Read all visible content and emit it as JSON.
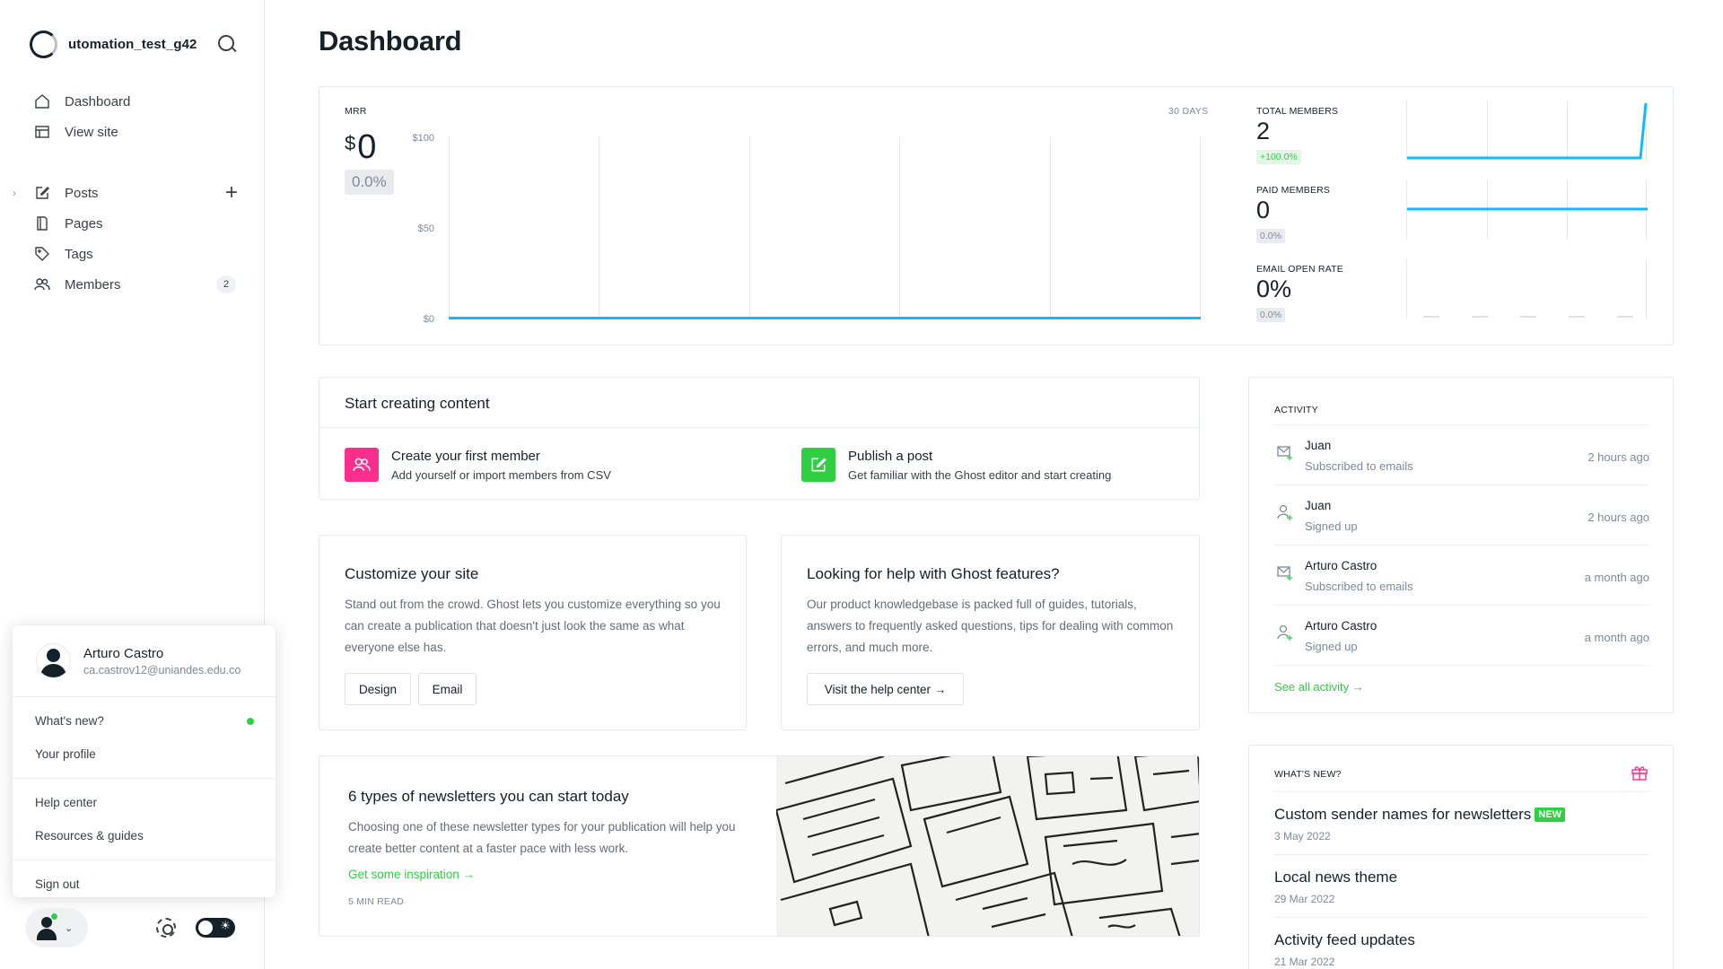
{
  "sidebar": {
    "site_name": "utomation_test_g42",
    "nav_top": [
      {
        "label": "Dashboard",
        "icon": "home-icon"
      },
      {
        "label": "View site",
        "icon": "browser-icon"
      }
    ],
    "nav_main": [
      {
        "label": "Posts",
        "icon": "edit-icon"
      },
      {
        "label": "Pages",
        "icon": "page-icon"
      },
      {
        "label": "Tags",
        "icon": "tag-icon"
      },
      {
        "label": "Members",
        "icon": "members-icon",
        "count": "2"
      }
    ]
  },
  "user_menu": {
    "name": "Arturo Castro",
    "email": "ca.castrov12@uniandes.edu.co",
    "items_group1": [
      "What's new?",
      "Your profile"
    ],
    "items_group2": [
      "Help center",
      "Resources & guides"
    ],
    "items_group3": [
      "Sign out"
    ]
  },
  "page": {
    "title": "Dashboard"
  },
  "mrr": {
    "label": "MRR",
    "currency": "$",
    "value": "0",
    "change": "0.0%",
    "period": "30 DAYS",
    "y_ticks": [
      "$100",
      "$50",
      "$0"
    ]
  },
  "stats": [
    {
      "label": "TOTAL MEMBERS",
      "value": "2",
      "change": "+100.0%",
      "trend": "up"
    },
    {
      "label": "PAID MEMBERS",
      "value": "0",
      "change": "0.0%",
      "trend": "flat"
    },
    {
      "label": "EMAIL OPEN RATE",
      "value": "0%",
      "change": "0.0%",
      "trend": "none"
    }
  ],
  "create": {
    "title": "Start creating content",
    "items": [
      {
        "title": "Create your first member",
        "sub": "Add yourself or import members from CSV",
        "color": "#fb2d8d"
      },
      {
        "title": "Publish a post",
        "sub": "Get familiar with the Ghost editor and start creating",
        "color": "#30cf43"
      }
    ]
  },
  "customize": {
    "title": "Customize your site",
    "body": "Stand out from the crowd. Ghost lets you customize everything so you can create a publication that doesn't just look the same as what everyone else has.",
    "buttons": [
      "Design",
      "Email"
    ]
  },
  "help": {
    "title": "Looking for help with Ghost features?",
    "body": "Our product knowledgebase is packed full of guides, tutorials, answers to frequently asked questions, tips for dealing with common errors, and much more.",
    "button": "Visit the help center →"
  },
  "newsletter": {
    "title": "6 types of newsletters you can start today",
    "body": "Choosing one of these newsletter types for your publication will help you create better content at a faster pace with less work.",
    "link": "Get some inspiration →",
    "read_time": "5 MIN READ"
  },
  "activity": {
    "title": "ACTIVITY",
    "items": [
      {
        "name": "Juan",
        "desc": "Subscribed to emails",
        "time": "2 hours ago",
        "icon": "email-subscribe-icon"
      },
      {
        "name": "Juan",
        "desc": "Signed up",
        "time": "2 hours ago",
        "icon": "user-add-icon"
      },
      {
        "name": "Arturo Castro",
        "desc": "Subscribed to emails",
        "time": "a month ago",
        "icon": "email-subscribe-icon"
      },
      {
        "name": "Arturo Castro",
        "desc": "Signed up",
        "time": "a month ago",
        "icon": "user-add-icon"
      }
    ],
    "see_all": "See all activity →"
  },
  "whats_new": {
    "title": "WHAT'S NEW?",
    "new_badge": "NEW",
    "items": [
      {
        "title": "Custom sender names for newsletters",
        "date": "3 May 2022"
      },
      {
        "title": "Local news theme",
        "date": "29 Mar 2022"
      },
      {
        "title": "Activity feed updates",
        "date": "21 Mar 2022"
      }
    ]
  },
  "colors": {
    "accent": "#30cf43",
    "chart_line": "#14b8ff",
    "member_icon": "#fb2d8d"
  }
}
